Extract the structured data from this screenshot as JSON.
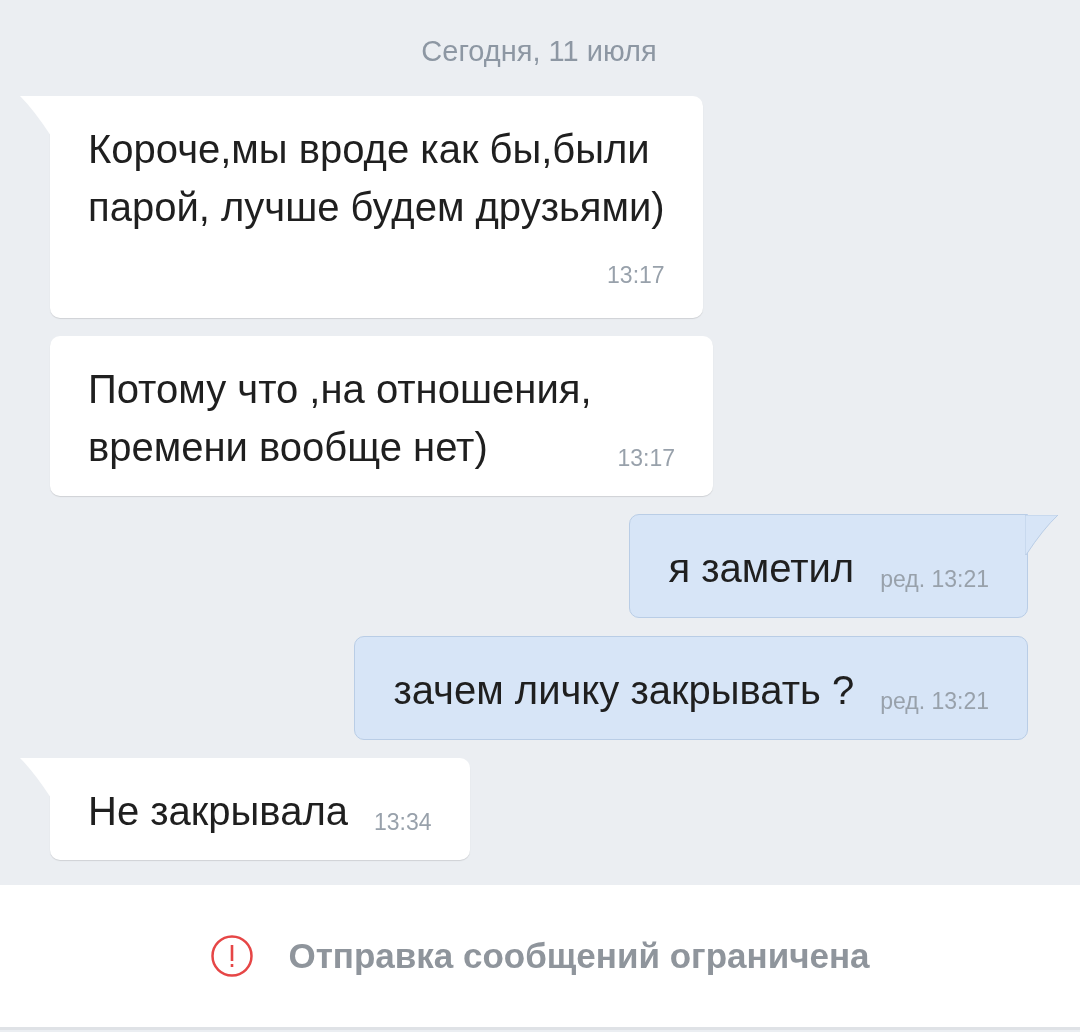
{
  "date_header": "Сегодня, 11 июля",
  "messages": [
    {
      "kind": "incoming",
      "tail": true,
      "lines": [
        "Короче,мы вроде как бы,были",
        "парой, лучше будем друзьями)"
      ],
      "time": "13:17",
      "time_below": true
    },
    {
      "kind": "incoming",
      "tail": false,
      "lines": [
        "Потому что ,на отношения,",
        "времени вообще нет)"
      ],
      "time": "13:17",
      "time_below": false
    },
    {
      "kind": "outgoing",
      "tail": true,
      "lines": [
        "я заметил"
      ],
      "time": "ред. 13:21",
      "time_below": false
    },
    {
      "kind": "outgoing",
      "tail": false,
      "lines": [
        "зачем личку закрывать ?"
      ],
      "time": "ред. 13:21",
      "time_below": false
    },
    {
      "kind": "incoming",
      "tail": true,
      "lines": [
        "Не закрывала"
      ],
      "time": "13:34",
      "time_below": false
    }
  ],
  "notice": "Отправка сообщений ограничена"
}
